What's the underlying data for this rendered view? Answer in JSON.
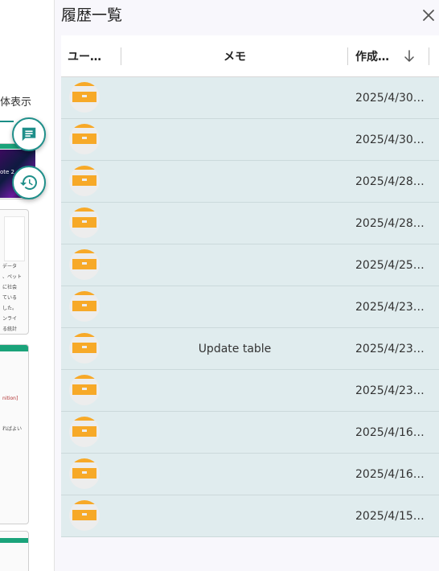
{
  "background": {
    "view_label": "体表示",
    "snippet_lines": [
      "データ",
      "、ペット",
      "に社会",
      "ている",
      "した。",
      "ンライ",
      "る統計"
    ],
    "snippet_red": "nition]",
    "snippet_small": "ればよい",
    "thumb_text": "ote 2"
  },
  "panel": {
    "title": "履歴一覧",
    "close_icon": "close-icon"
  },
  "table": {
    "columns": [
      "ユー…",
      "メモ",
      "作成…"
    ],
    "sort_icon": "arrow-down-icon",
    "rows": [
      {
        "memo": "",
        "date": "2025/4/30…"
      },
      {
        "memo": "",
        "date": "2025/4/30…"
      },
      {
        "memo": "",
        "date": "2025/4/28…"
      },
      {
        "memo": "",
        "date": "2025/4/28…"
      },
      {
        "memo": "",
        "date": "2025/4/25…"
      },
      {
        "memo": "",
        "date": "2025/4/23…"
      },
      {
        "memo": "Update table",
        "date": "2025/4/23…"
      },
      {
        "memo": "",
        "date": "2025/4/23…"
      },
      {
        "memo": "",
        "date": "2025/4/16…"
      },
      {
        "memo": "",
        "date": "2025/4/16…"
      },
      {
        "memo": "",
        "date": "2025/4/15…"
      }
    ]
  },
  "colors": {
    "accent": "#1f8f8a",
    "row_bg": "#e0ecee",
    "avatar": "#f7a928",
    "green": "#1aa37a"
  }
}
